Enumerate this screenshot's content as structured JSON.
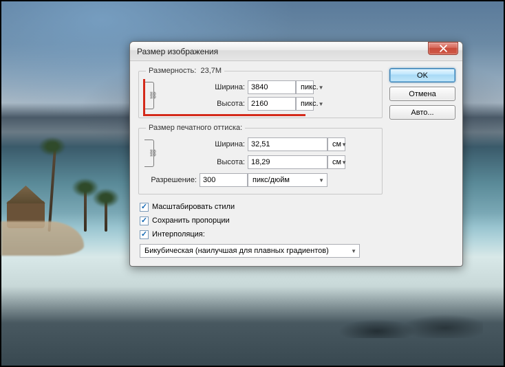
{
  "dialog": {
    "title": "Размер изображения",
    "buttons": {
      "ok": "OK",
      "cancel": "Отмена",
      "auto": "Авто..."
    }
  },
  "pixel_dims": {
    "legend_label": "Размерность:",
    "file_size": "23,7M",
    "width_label": "Ширина:",
    "width_value": "3840",
    "width_unit": "пикс.",
    "height_label": "Высота:",
    "height_value": "2160",
    "height_unit": "пикс."
  },
  "print_dims": {
    "legend": "Размер печатного оттиска:",
    "width_label": "Ширина:",
    "width_value": "32,51",
    "width_unit": "см",
    "height_label": "Высота:",
    "height_value": "18,29",
    "height_unit": "см",
    "res_label": "Разрешение:",
    "res_value": "300",
    "res_unit": "пикс/дюйм"
  },
  "options": {
    "scale_styles": "Масштабировать стили",
    "constrain": "Сохранить пропорции",
    "resample": "Интерполяция:",
    "method": "Бикубическая (наилучшая для плавных градиентов)"
  }
}
